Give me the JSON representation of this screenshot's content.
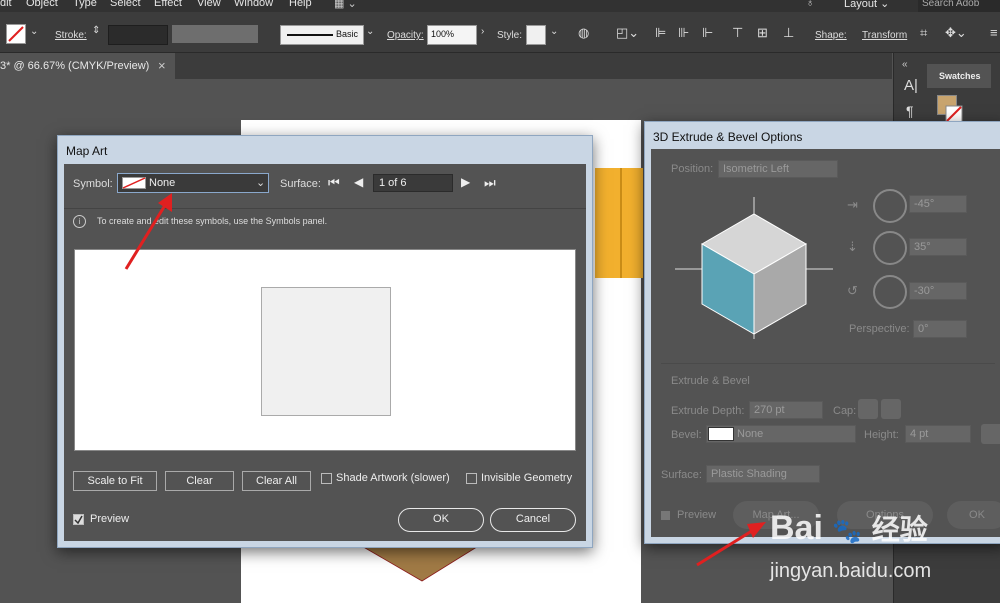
{
  "menubar": {
    "items": [
      "dit",
      "Object",
      "Type",
      "Select",
      "Effect",
      "View",
      "Window",
      "Help"
    ],
    "workspace": "Layout",
    "search_placeholder": "Search Adob"
  },
  "controlbar": {
    "stroke_label": "Stroke:",
    "brush_label": "Basic",
    "opacity_label": "Opacity:",
    "opacity_value": "100%",
    "style_label": "Style:",
    "shape_label": "Shape:",
    "transform_label": "Transform"
  },
  "document_tab": {
    "title": "3* @ 66.67% (CMYK/Preview)",
    "close": "×"
  },
  "swatches": {
    "tab_label": "Swatches",
    "swatch_color": "#c8a46e"
  },
  "map_art": {
    "title": "Map Art",
    "symbol_label": "Symbol:",
    "symbol_value": "None",
    "surface_label": "Surface:",
    "surface_value": "1 of 6",
    "info_text": "To create and edit these symbols, use the Symbols panel.",
    "buttons": {
      "scale_to_fit": "Scale to Fit",
      "clear": "Clear",
      "clear_all": "Clear All",
      "ok": "OK",
      "cancel": "Cancel"
    },
    "shade_artwork_label": "Shade Artwork (slower)",
    "invisible_geometry_label": "Invisible Geometry",
    "preview_label": "Preview",
    "preview_checked": true
  },
  "extrude": {
    "title": "3D Extrude & Bevel Options",
    "position_label": "Position:",
    "position_value": "Isometric Left",
    "rot_x": "-45°",
    "rot_y": "35°",
    "rot_z": "-30°",
    "perspective_label": "Perspective:",
    "perspective_value": "0°",
    "section_label": "Extrude & Bevel",
    "depth_label": "Extrude Depth:",
    "depth_value": "270 pt",
    "cap_label": "Cap:",
    "bevel_label": "Bevel:",
    "bevel_value": "None",
    "height_label": "Height:",
    "height_value": "4 pt",
    "surface_label": "Surface:",
    "surface_value": "Plastic Shading",
    "preview_label": "Preview",
    "map_art_button": "Map Art...",
    "more_options_button": "Options",
    "ok_button": "OK"
  },
  "watermark": {
    "brand": "Bai",
    "brand2": "经验",
    "url": "jingyan.baidu.com"
  },
  "colors": {
    "annotation_arrow": "#e02020",
    "cube_left": "#5aa3b5",
    "cube_top": "#d6d6d6",
    "cube_right": "#a9a9a9",
    "orange_shape": "#f2b02e"
  }
}
